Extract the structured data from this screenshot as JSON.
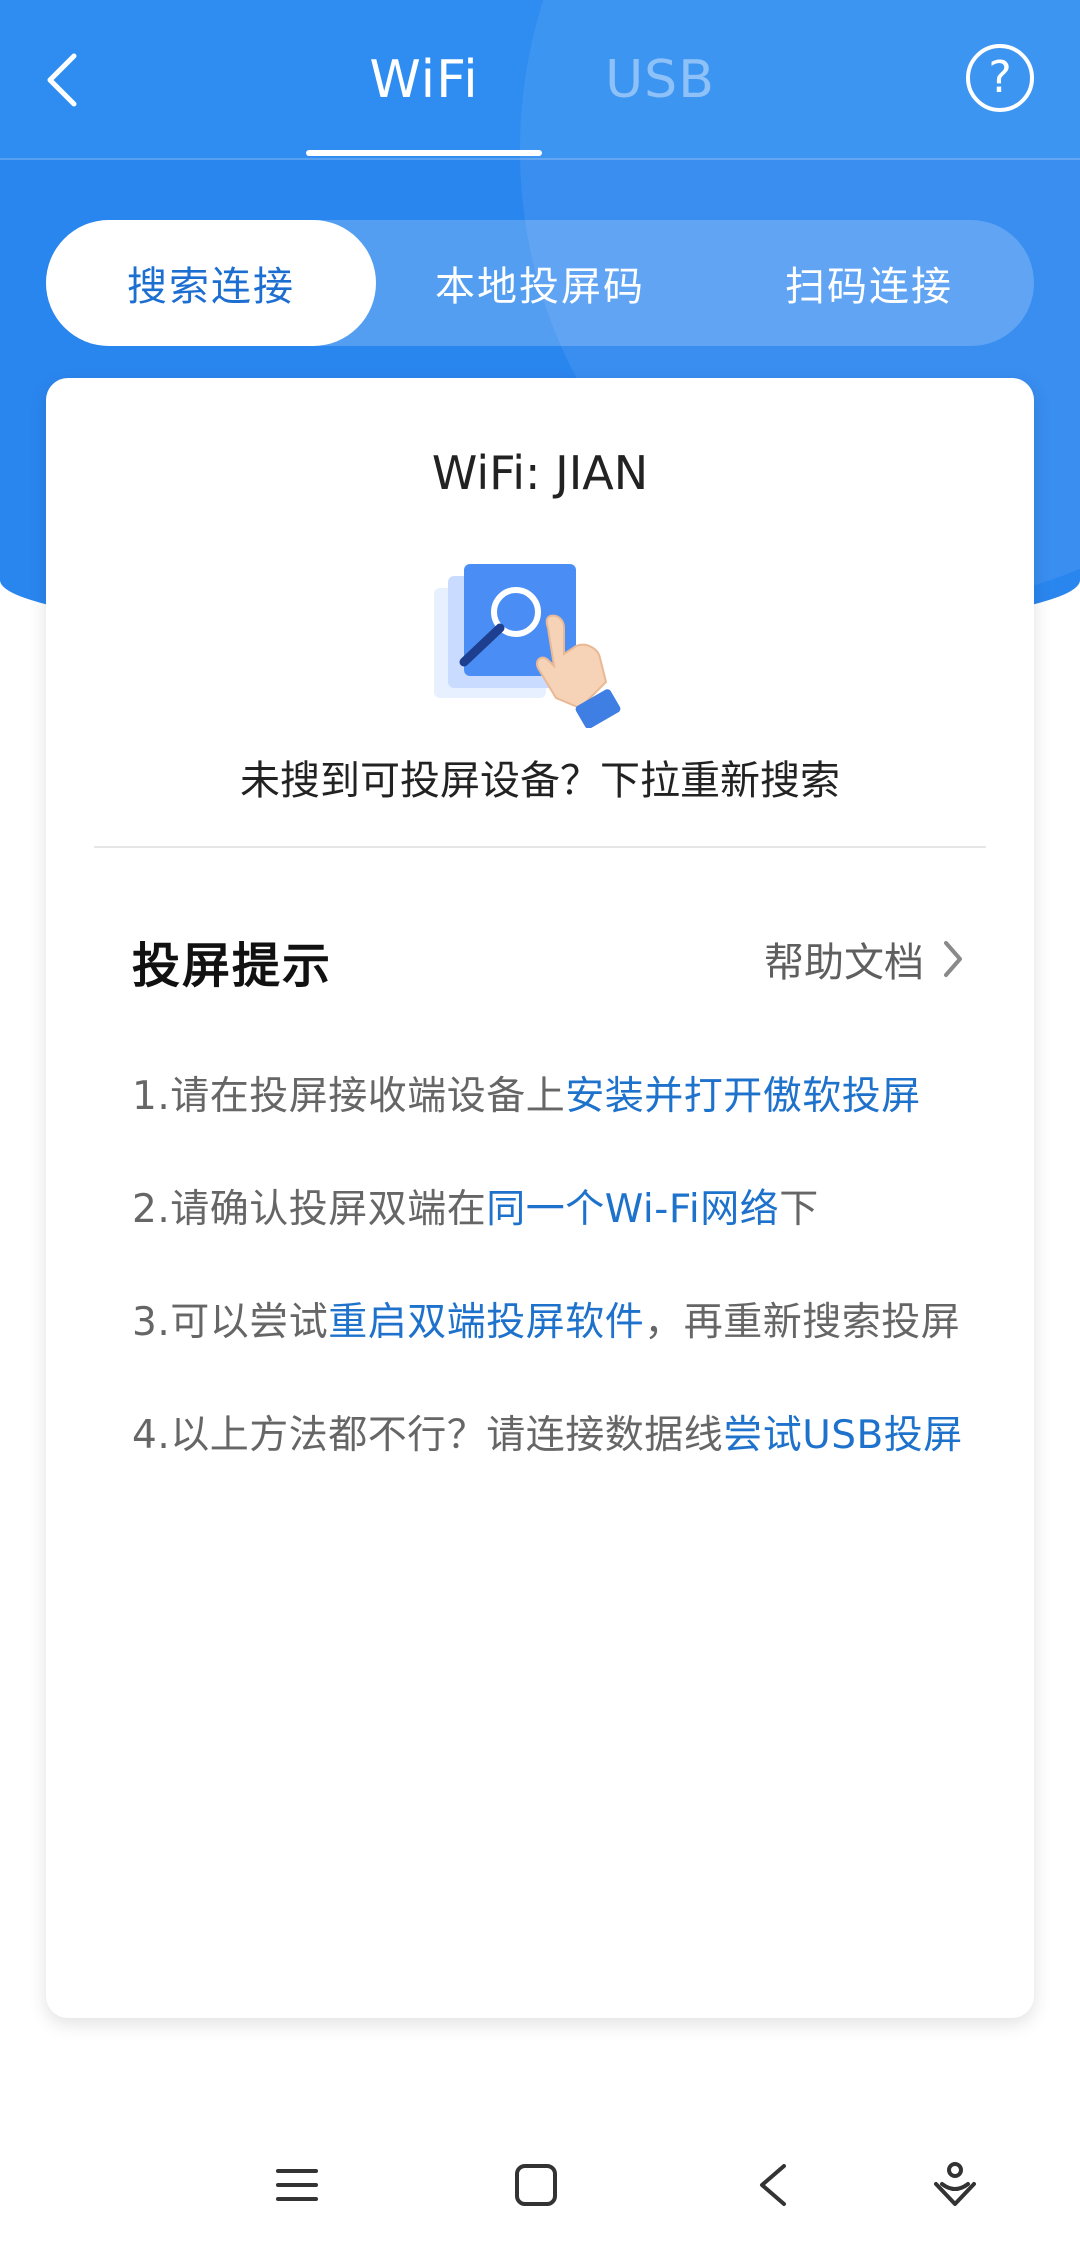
{
  "header": {
    "tabs": [
      {
        "label": "WiFi",
        "active": true
      },
      {
        "label": "USB",
        "active": false
      }
    ],
    "back_icon": "chevron-left-icon",
    "help_icon": "question-circle-icon",
    "help_glyph": "?"
  },
  "mode_switch": {
    "options": [
      {
        "label": "搜索连接",
        "active": true
      },
      {
        "label": "本地投屏码",
        "active": false
      },
      {
        "label": "扫码连接",
        "active": false
      }
    ]
  },
  "card": {
    "wifi_label": "WiFi: JIAN",
    "illustration_icon": "search-tap-illustration",
    "no_device_text": "未搜到可投屏设备？下拉重新搜索",
    "tips_title": "投屏提示",
    "help_doc_label": "帮助文档",
    "tips": [
      {
        "prefix": "1.请在投屏接收端设备上",
        "highlight": "安装并打开傲软投屏",
        "suffix": ""
      },
      {
        "prefix": "2.请确认投屏双端在",
        "highlight": "同一个Wi-Fi网络",
        "suffix": "下"
      },
      {
        "prefix": "3.可以尝试",
        "highlight": "重启双端投屏软件",
        "suffix": "，再重新搜索投屏"
      },
      {
        "prefix": "4.以上方法都不行？请连接数据线",
        "highlight": "尝试USB投屏",
        "suffix": ""
      }
    ]
  },
  "nav": {
    "items": [
      "menu-icon",
      "home-square-icon",
      "back-triangle-icon",
      "assistant-icon"
    ]
  },
  "colors": {
    "header_blue": "#2a86ef",
    "link_blue": "#1e72cc",
    "active_text": "#1c6fd1"
  }
}
